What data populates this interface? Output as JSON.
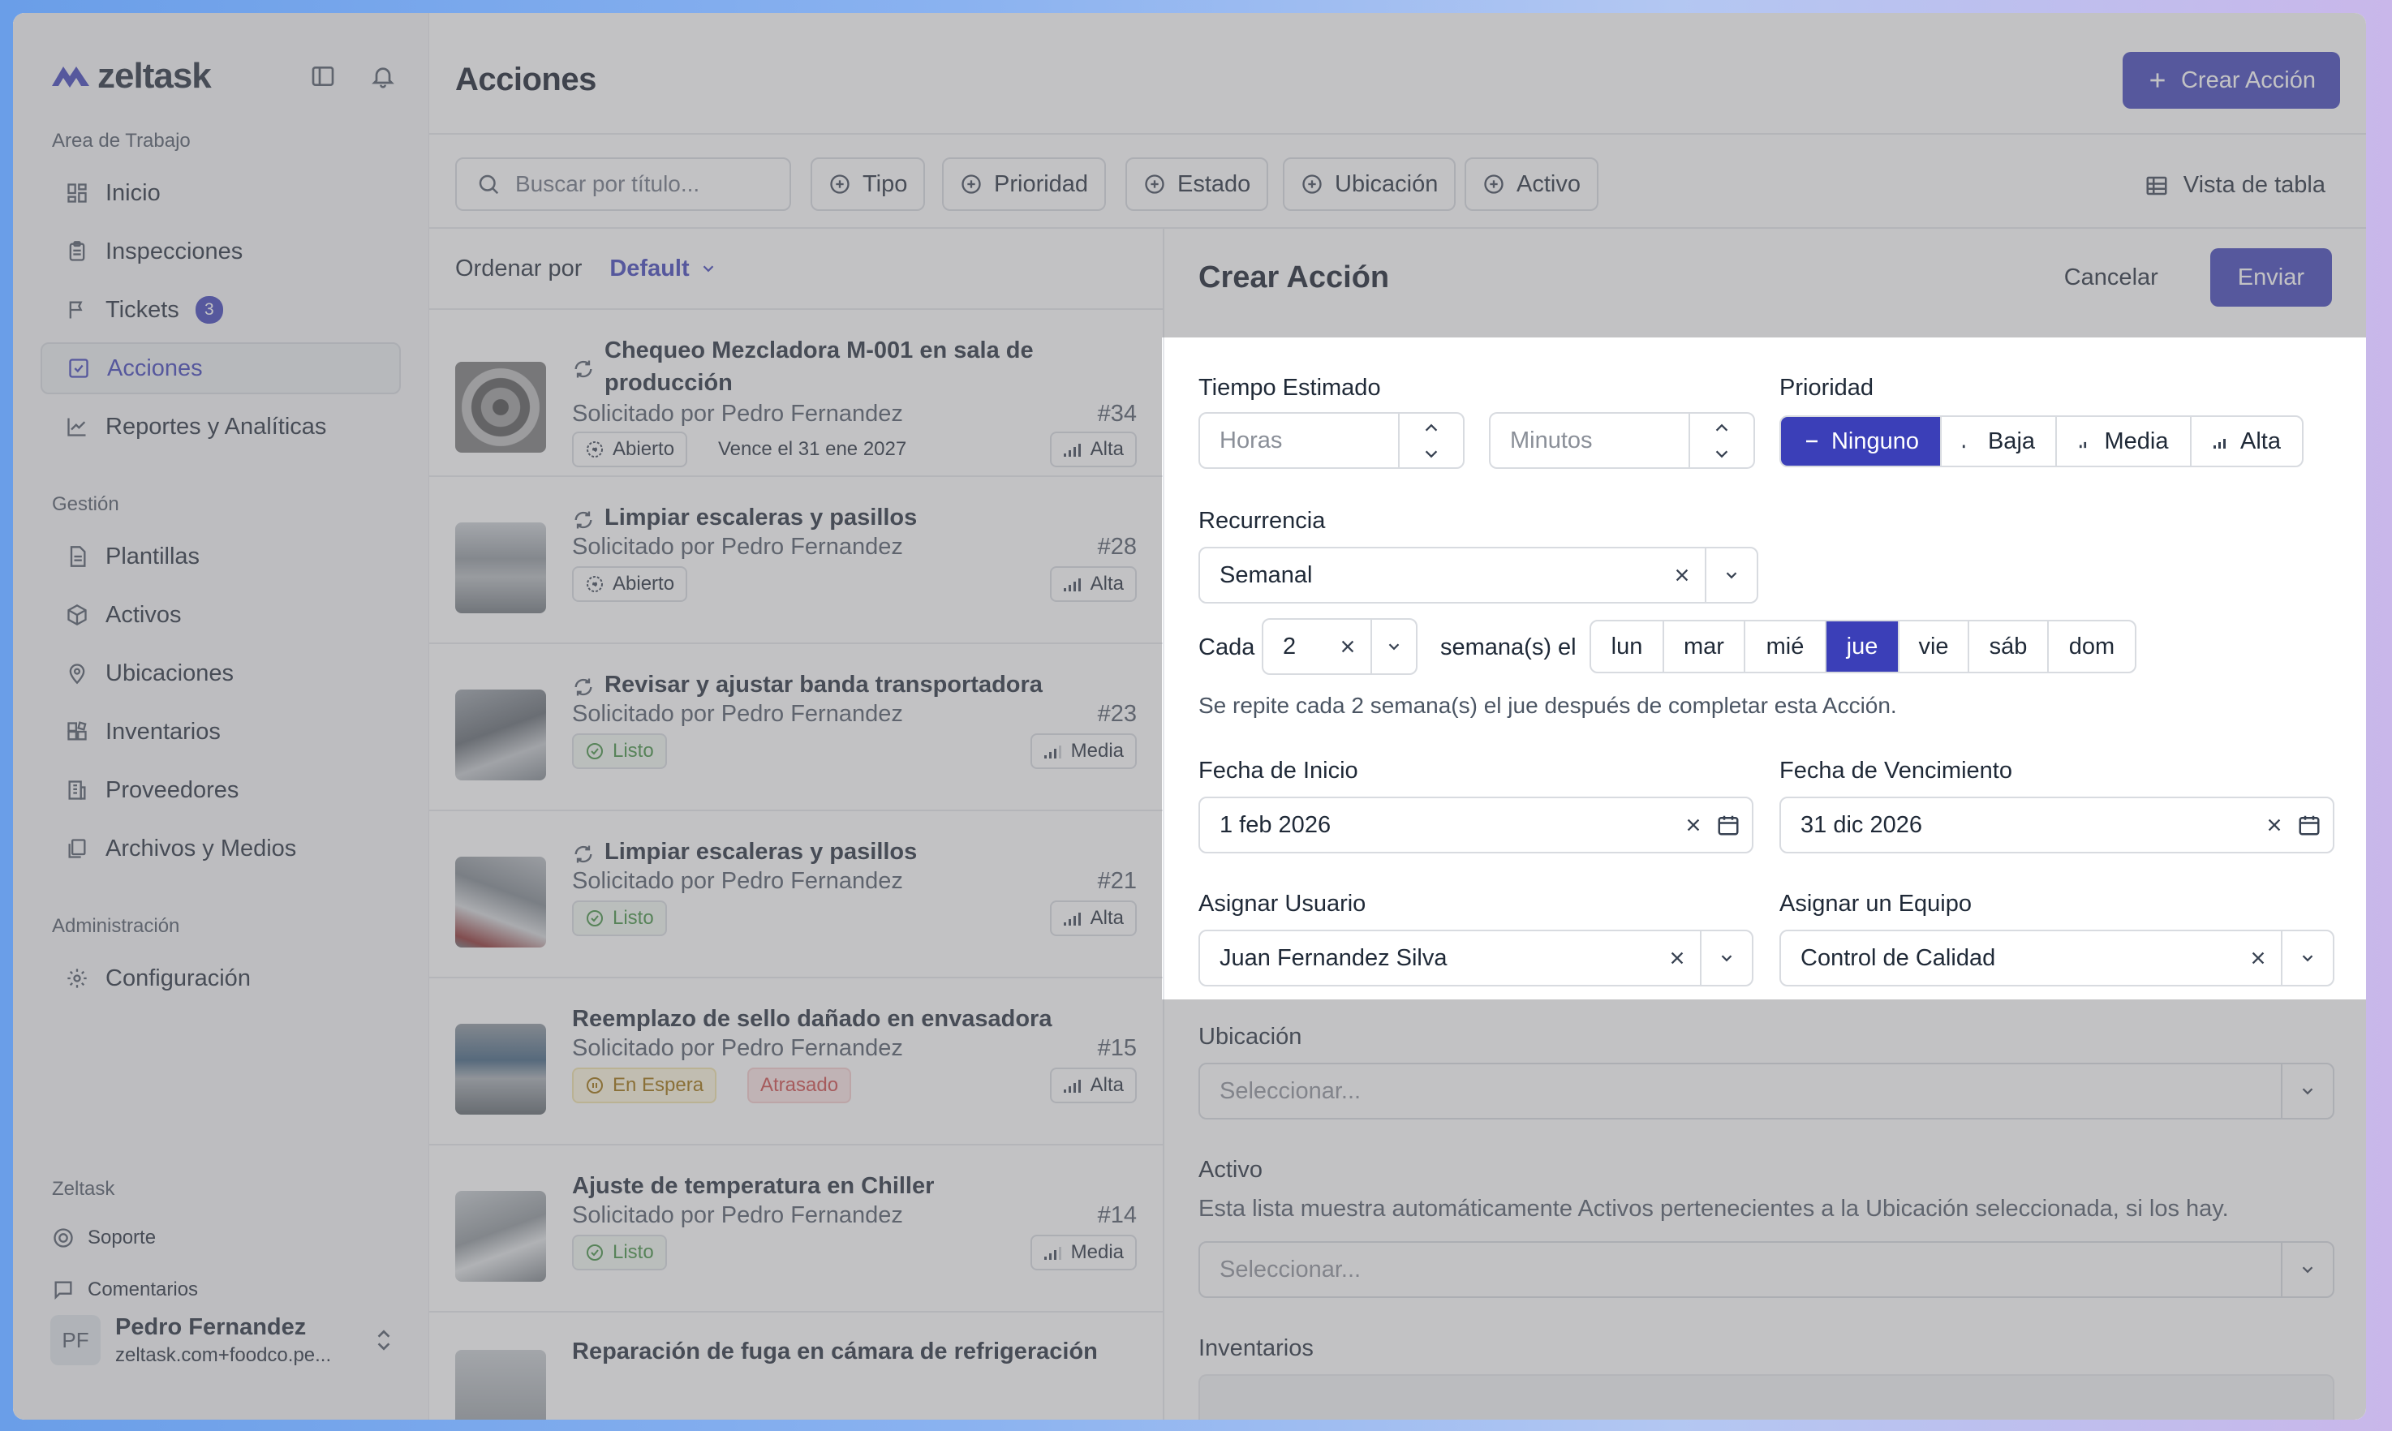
{
  "app": {
    "brand": "zeltask"
  },
  "sidebar": {
    "section_workspace": "Area de Trabajo",
    "workspace_items": [
      {
        "label": "Inicio",
        "icon": "home-grid-icon"
      },
      {
        "label": "Inspecciones",
        "icon": "clipboard-icon"
      },
      {
        "label": "Tickets",
        "icon": "flag-icon",
        "badge": "3"
      },
      {
        "label": "Acciones",
        "icon": "check-square-icon",
        "active": true
      },
      {
        "label": "Reportes y Analíticas",
        "icon": "chart-line-icon"
      }
    ],
    "section_management": "Gestión",
    "management_items": [
      {
        "label": "Plantillas",
        "icon": "template-icon"
      },
      {
        "label": "Activos",
        "icon": "cube-icon"
      },
      {
        "label": "Ubicaciones",
        "icon": "map-pin-icon"
      },
      {
        "label": "Inventarios",
        "icon": "boxes-icon"
      },
      {
        "label": "Proveedores",
        "icon": "building-icon"
      },
      {
        "label": "Archivos y Medios",
        "icon": "files-icon"
      }
    ],
    "section_admin": "Administración",
    "admin_items": [
      {
        "label": "Configuración",
        "icon": "gear-icon"
      }
    ],
    "section_zeltask": "Zeltask",
    "support": "Soporte",
    "feedback": "Comentarios",
    "user": {
      "initials": "PF",
      "name": "Pedro Fernandez",
      "email": "zeltask.com+foodco.pe..."
    }
  },
  "header": {
    "title": "Acciones",
    "create_button": "Crear Acción"
  },
  "filters": {
    "search_placeholder": "Buscar por título...",
    "chips": [
      "Tipo",
      "Prioridad",
      "Estado",
      "Ubicación",
      "Activo"
    ],
    "view_toggle": "Vista de tabla"
  },
  "sort": {
    "label": "Ordenar por",
    "value": "Default"
  },
  "actions": [
    {
      "title": "Chequeo Mezcladora M-001 en sala de producción",
      "requested": "Solicitado por Pedro Fernandez",
      "number": "#34",
      "status": "Abierto",
      "due": "Vence el 31 ene 2027",
      "priority": "Alta",
      "recurring": true
    },
    {
      "title": "Limpiar escaleras y pasillos",
      "requested": "Solicitado por Pedro Fernandez",
      "number": "#28",
      "status": "Abierto",
      "priority": "Alta",
      "recurring": true
    },
    {
      "title": "Revisar y ajustar banda transportadora",
      "requested": "Solicitado por Pedro Fernandez",
      "number": "#23",
      "status": "Listo",
      "priority": "Media",
      "recurring": true
    },
    {
      "title": "Limpiar escaleras y pasillos",
      "requested": "Solicitado por Pedro Fernandez",
      "number": "#21",
      "status": "Listo",
      "priority": "Alta",
      "recurring": true
    },
    {
      "title": "Reemplazo de sello dañado en envasadora",
      "requested": "Solicitado por Pedro Fernandez",
      "number": "#15",
      "status": "En Espera",
      "extra": "Atrasado",
      "priority": "Alta",
      "recurring": false
    },
    {
      "title": "Ajuste de temperatura en Chiller",
      "requested": "Solicitado por Pedro Fernandez",
      "number": "#14",
      "status": "Listo",
      "priority": "Media",
      "recurring": false
    },
    {
      "title": "Reparación de fuga en cámara de refrigeración",
      "requested": "",
      "number": "",
      "status": "",
      "priority": "",
      "recurring": false
    }
  ],
  "form": {
    "title": "Crear Acción",
    "cancel": "Cancelar",
    "submit": "Enviar",
    "estimated_time_label": "Tiempo Estimado",
    "hours_placeholder": "Horas",
    "minutes_placeholder": "Minutos",
    "priority_label": "Prioridad",
    "priority_options": [
      "Ninguno",
      "Baja",
      "Media",
      "Alta"
    ],
    "priority_selected": "Ninguno",
    "recurrence_label": "Recurrencia",
    "recurrence_value": "Semanal",
    "every_label": "Cada",
    "every_value": "2",
    "weeks_label": "semana(s) el",
    "days": [
      "lun",
      "mar",
      "mié",
      "jue",
      "vie",
      "sáb",
      "dom"
    ],
    "day_selected": "jue",
    "recurrence_hint": "Se repite cada 2 semana(s) el jue después de completar esta Acción.",
    "start_label": "Fecha de Inicio",
    "start_value": "1 feb 2026",
    "due_label": "Fecha de Vencimiento",
    "due_value": "31 dic 2026",
    "assign_user_label": "Asignar Usuario",
    "assign_user_value": "Juan Fernandez Silva",
    "assign_team_label": "Asignar un Equipo",
    "assign_team_value": "Control de Calidad",
    "location_label": "Ubicación",
    "location_placeholder": "Seleccionar...",
    "asset_label": "Activo",
    "asset_hint": "Esta lista muestra automáticamente Activos pertenecientes a la Ubicación seleccionada, si los hay.",
    "asset_placeholder": "Seleccionar...",
    "inventory_label": "Inventarios"
  },
  "colors": {
    "accent": "#3b3fb8",
    "background": "#f6f6f7"
  }
}
